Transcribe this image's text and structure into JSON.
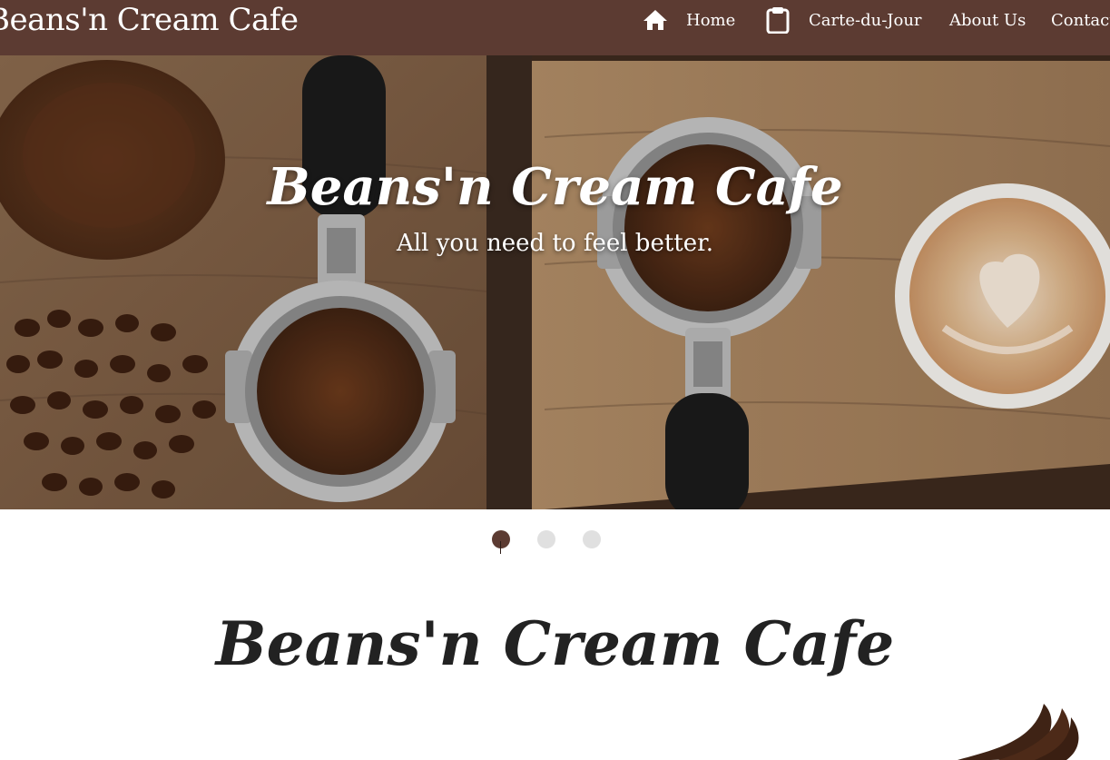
{
  "navbar": {
    "brand": "Beans'n Cream Cafe",
    "items": [
      {
        "label": "Home",
        "icon": "home-icon"
      },
      {
        "label": "Carte-du-Jour",
        "icon": "clipboard-icon"
      },
      {
        "label": "About Us"
      },
      {
        "label": "Contact"
      }
    ]
  },
  "hero": {
    "title": "Beans'n Cream Cafe",
    "subtitle": "All you need to feel better."
  },
  "carousel": {
    "slides": 3,
    "active": 1
  },
  "section": {
    "title": "Beans'n Cream Cafe"
  },
  "colors": {
    "brand_brown": "#5c3b32",
    "dot_inactive": "#e0e0e0",
    "text_dark": "#222222"
  }
}
